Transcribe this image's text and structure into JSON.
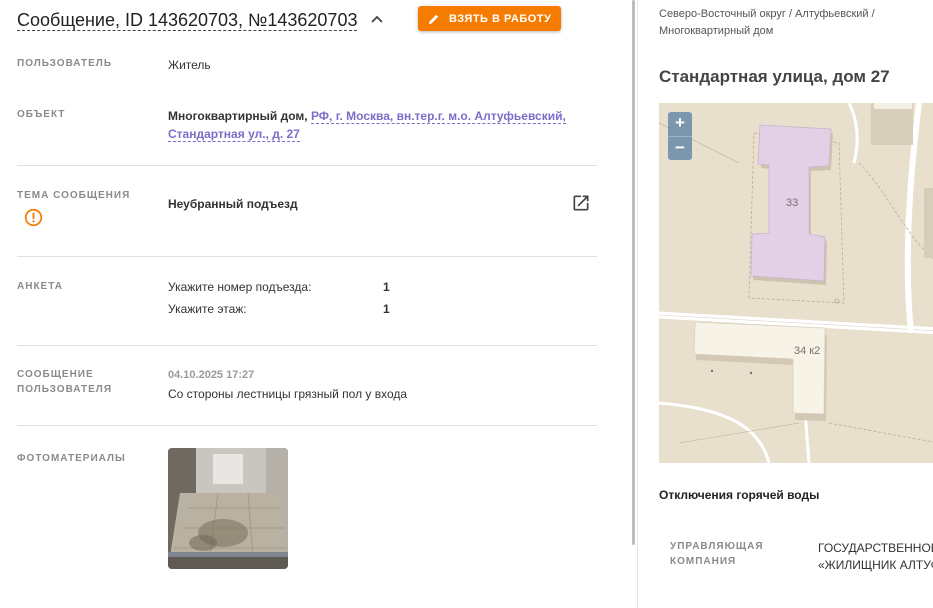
{
  "header": {
    "title": "Сообщение, ID 143620703, №143620703",
    "take_button": "ВЗЯТЬ В РАБОТУ"
  },
  "fields": {
    "user": {
      "label": "ПОЛЬЗОВАТЕЛЬ",
      "value": "Житель"
    },
    "object": {
      "label": "ОБЪЕКТ",
      "type": "Многоквартирный дом,",
      "address_link": "РФ, г. Москва, вн.тер.г. м.о. Алтуфьевский, Стандартная ул., д. 27"
    },
    "topic": {
      "label": "ТЕМА СООБЩЕНИЯ",
      "value": "Неубранный подъезд"
    },
    "survey": {
      "label": "АНКЕТА",
      "rows": [
        {
          "question": "Укажите номер подъезда:",
          "answer": "1"
        },
        {
          "question": "Укажите этаж:",
          "answer": "1"
        }
      ]
    },
    "message": {
      "label_line1": "СООБЩЕНИЕ",
      "label_line2": "ПОЛЬЗОВАТЕЛЯ",
      "date": "04.10.2025 17:27",
      "text": "Со стороны лестницы грязный пол у входа"
    },
    "photos": {
      "label": "ФОТОМАТЕРИАЛЫ"
    }
  },
  "right": {
    "breadcrumb_line1": "Северо-Восточный округ / Алтуфьевский /",
    "breadcrumb_line2": "Многоквартирный дом",
    "address": "Стандартная улица, дом 27",
    "map": {
      "zoom_in": "+",
      "zoom_out": "−",
      "building_1": "33",
      "building_2": "34 к2"
    },
    "hot_water_title": "Отключения горячей воды",
    "mgmt_label_line1": "УПРАВЛЯЮЩАЯ",
    "mgmt_label_line2": "КОМПАНИЯ",
    "mgmt_value_line1": "ГОСУДАРСТВЕННОЕ",
    "mgmt_value_line2": "«ЖИЛИЩНИК АЛТУФ"
  },
  "colors": {
    "accent": "#f57c00",
    "link": "#7e6cc8",
    "warning": "#f57c00",
    "map_bg": "#e8e0cc",
    "building_highlight": "#e3cfe6"
  },
  "icons": {
    "chevron": "chevron-up-icon",
    "take": "pencil-icon",
    "topic": "warning-icon",
    "open": "open-in-new-icon"
  }
}
